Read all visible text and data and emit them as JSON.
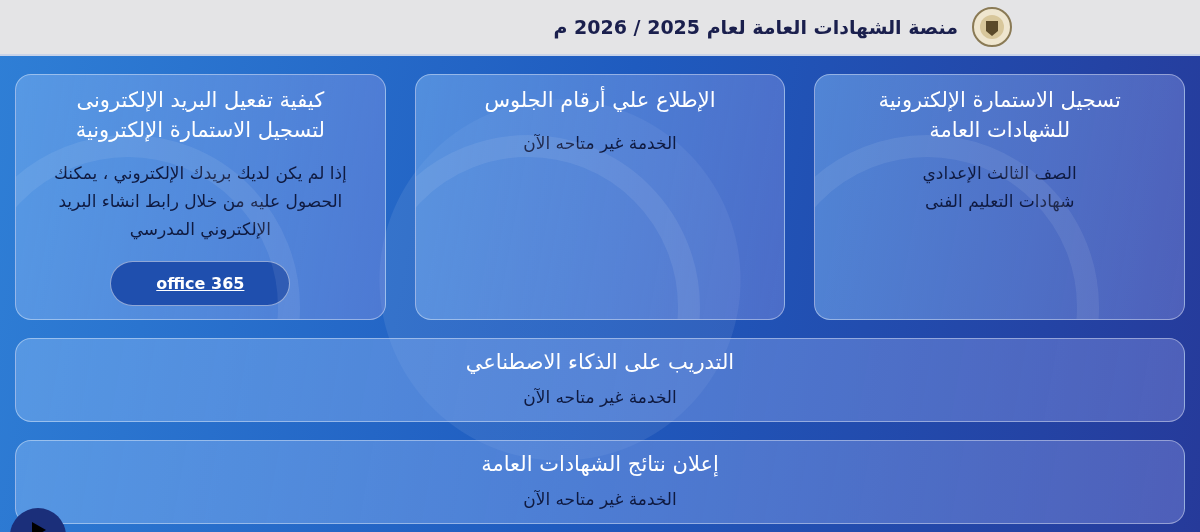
{
  "header": {
    "title": "منصة الشهادات العامة لعام 2025 / 2026 م"
  },
  "cards": [
    {
      "title": "تسجيل الاستمارة الإلكترونية للشهادات العامة",
      "lines": [
        "الصف الثالث الإعدادي",
        "شهادات التعليم الفنى"
      ]
    },
    {
      "title": "الإطلاع علي أرقام الجلوس",
      "lines": [
        "الخدمة غير متاحه الآن"
      ]
    },
    {
      "title": "كيفية تفعيل البريد الإلكترونى لتسجيل الاستمارة الإلكترونية",
      "lines": [
        "إذا لم يكن لديك بريدك الإلكتروني ، يمكنك الحصول عليه من خلال رابط انشاء البريد الإلكتروني المدرسي"
      ],
      "button": "office 365"
    }
  ],
  "wide_cards": [
    {
      "title": "التدريب على الذكاء الاصطناعي",
      "lines": [
        "الخدمة غير متاحه الآن"
      ]
    },
    {
      "title": "إعلان نتائج الشهادات العامة",
      "lines": [
        "الخدمة غير متاحه الآن"
      ]
    }
  ]
}
